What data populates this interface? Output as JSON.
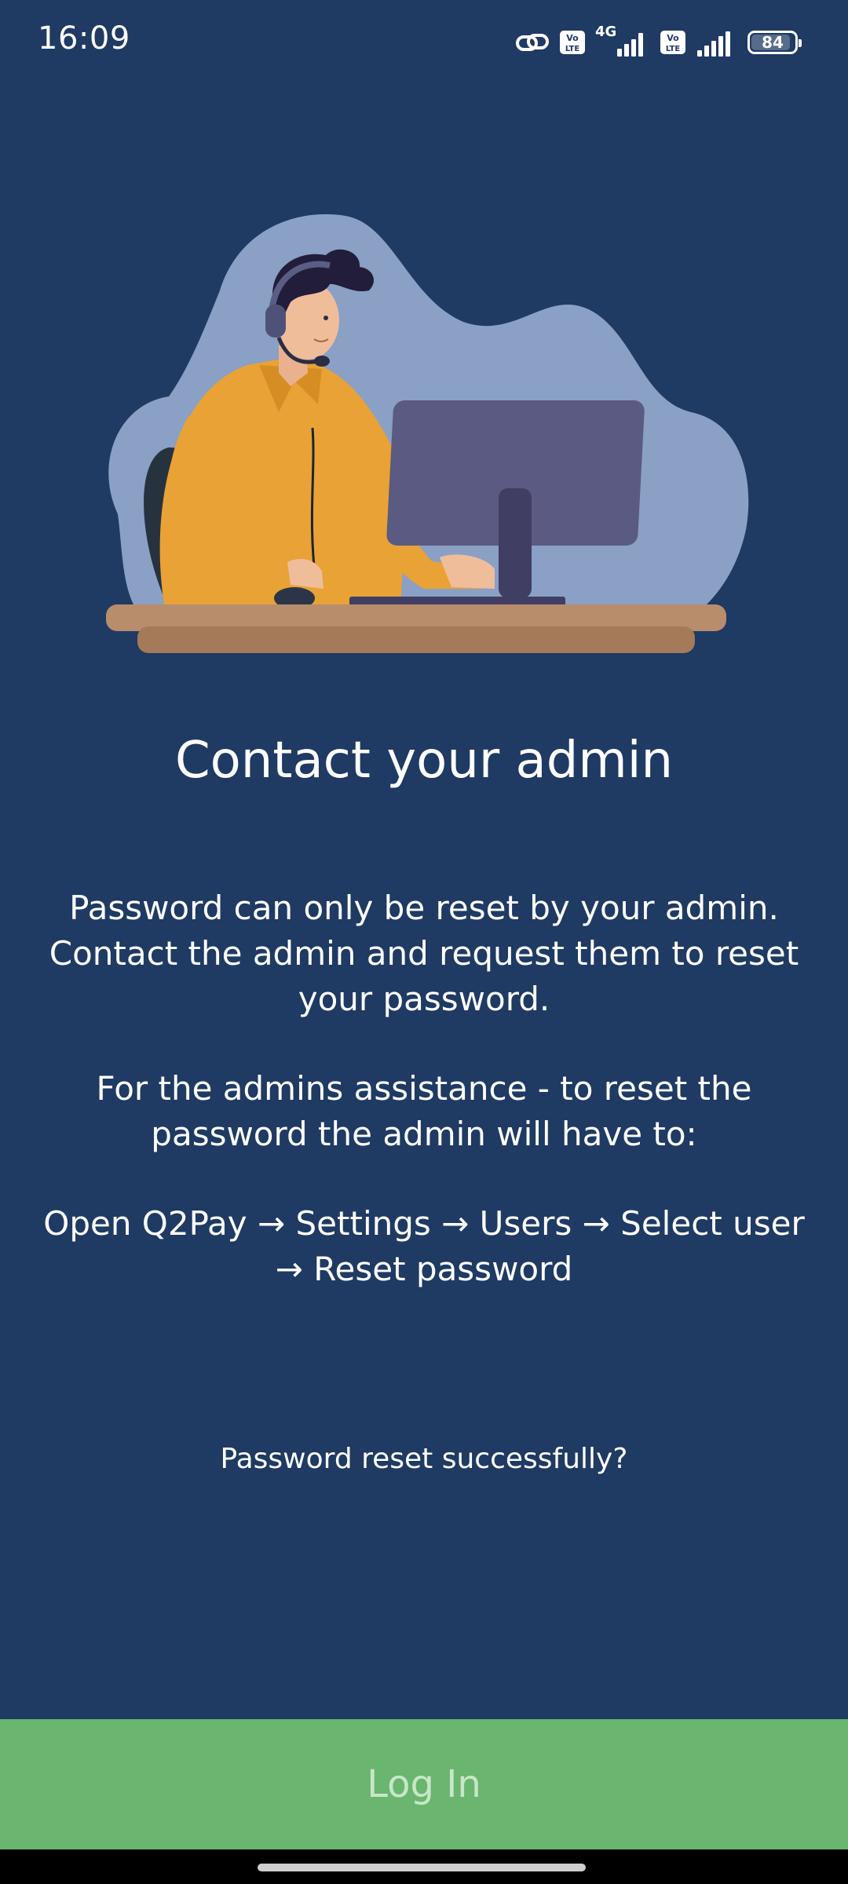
{
  "status_bar": {
    "time": "16:09",
    "network_label": "4G",
    "battery_level": "84",
    "icons": [
      "link-icon",
      "volte-icon",
      "signal-icon",
      "volte-icon",
      "signal-icon",
      "battery-icon"
    ]
  },
  "colors": {
    "background": "#1f3a63",
    "button": "#6ab56f",
    "button_text": "#c7e7c7"
  },
  "content": {
    "title": "Contact your admin",
    "description_1": "Password can only be reset by your admin. Contact the admin and request them to reset your password.",
    "description_2": "For the admins assistance - to reset the password the admin will have to:",
    "description_3": "Open Q2Pay → Settings → Users → Select user → Reset password",
    "reset_question": "Password reset successfully?"
  },
  "footer": {
    "login_label": "Log In"
  }
}
